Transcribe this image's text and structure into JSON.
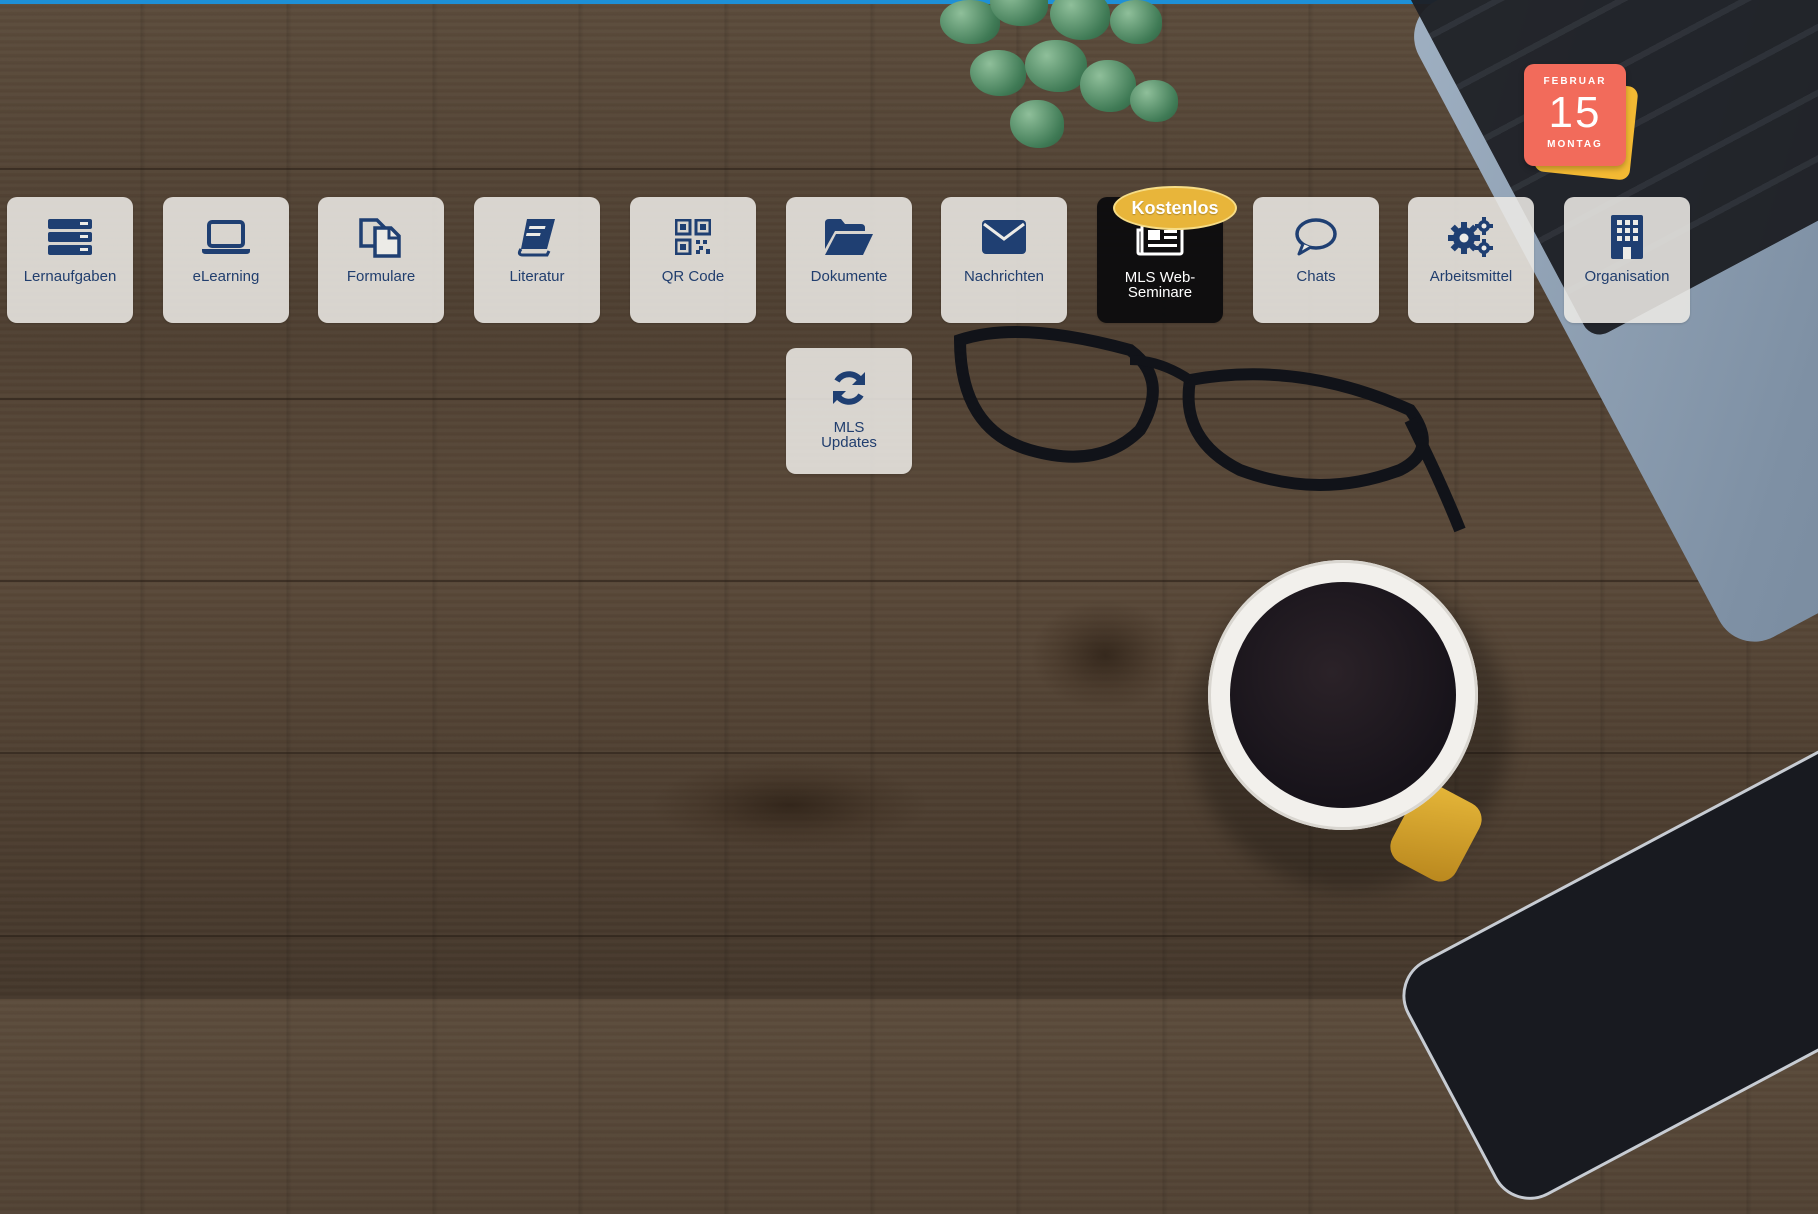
{
  "calendar": {
    "month": "FEBRUAR",
    "day": "15",
    "weekday": "MONTAG"
  },
  "tiles": [
    {
      "label": "Lernaufgaben",
      "icon": "server-stack-icon"
    },
    {
      "label": "eLearning",
      "icon": "laptop-icon"
    },
    {
      "label": "Formulare",
      "icon": "copy-documents-icon"
    },
    {
      "label": "Literatur",
      "icon": "book-icon"
    },
    {
      "label": "QR Code",
      "icon": "qr-code-icon"
    },
    {
      "label": "Dokumente",
      "icon": "folder-open-icon"
    },
    {
      "label": "Nachrichten",
      "icon": "envelope-icon"
    },
    {
      "label": "MLS Web-\nSeminare",
      "icon": "newspaper-icon"
    },
    {
      "label": "Chats",
      "icon": "speech-bubble-icon"
    },
    {
      "label": "Arbeitsmittel",
      "icon": "gears-icon"
    },
    {
      "label": "Organisation",
      "icon": "building-icon"
    },
    {
      "label": "MLS\nUpdates",
      "icon": "refresh-icon"
    }
  ],
  "badge": {
    "label": "Kostenlos"
  },
  "colors": {
    "accent": "#1e90d6",
    "tile_icon": "#1f3f72",
    "badge": "#e8b53a",
    "calendar": "#f26b5b"
  }
}
